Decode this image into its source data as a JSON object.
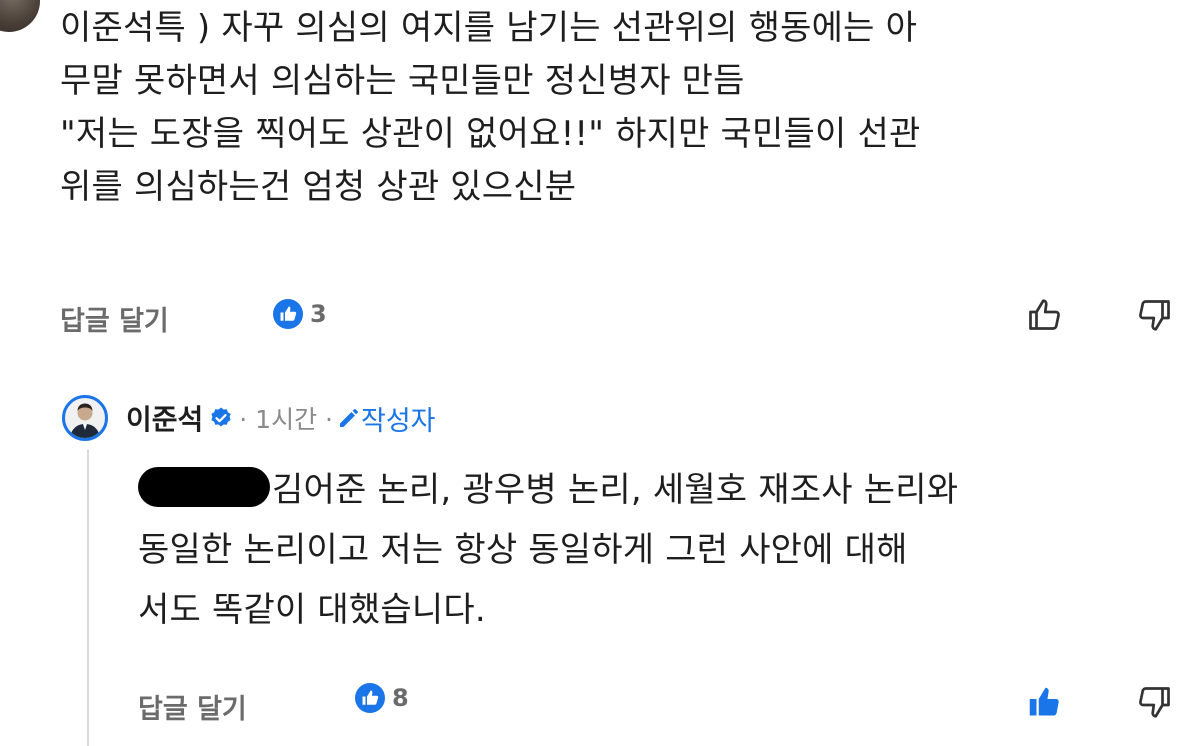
{
  "comment": {
    "lines": [
      "이준석특 ) 자꾸 의심의 여지를 남기는 선관위의 행동에는 아",
      "무말 못하면서 의심하는 국민들만 정신병자 만듬",
      "\"저는 도장을 찍어도 상관이 없어요!!\" 하지만 국민들이 선관",
      "위를 의심하는건 엄청 상관 있으신분"
    ],
    "reply_button": "답글 달기",
    "like_count": "3",
    "liked": false
  },
  "reply": {
    "author": "이준석",
    "verified": true,
    "time": "· 1시간 ·",
    "author_tag": "작성자",
    "lines": [
      "김어준 논리, 광우병 논리, 세월호 재조사 논리와",
      "동일한 논리이고 저는 항상 동일하게 그런 사안에 대해",
      "서도 똑같이 대했습니다."
    ],
    "reply_button": "답글 달기",
    "like_count": "8",
    "liked": true
  },
  "colors": {
    "accent": "#1a75e8",
    "muted_text": "#6b6b6b",
    "body_text": "#1e1e1e"
  },
  "icons": [
    "thumbs-up-icon",
    "thumbs-down-icon",
    "verified-badge-icon",
    "pencil-icon",
    "like-bubble-icon"
  ]
}
